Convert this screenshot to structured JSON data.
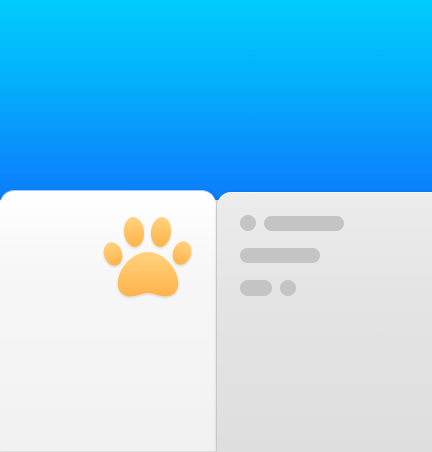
{
  "icon": {
    "name": "paw-icon",
    "color": "#ffb74d",
    "highlight_color": "#ffd27e"
  },
  "colors": {
    "sky_top": "#00cdfb",
    "sky_bottom": "#0b7ef9",
    "left_panel": "#f4f4f4",
    "right_panel": "#e3e3e3",
    "placeholder": "#c4c4c4"
  }
}
